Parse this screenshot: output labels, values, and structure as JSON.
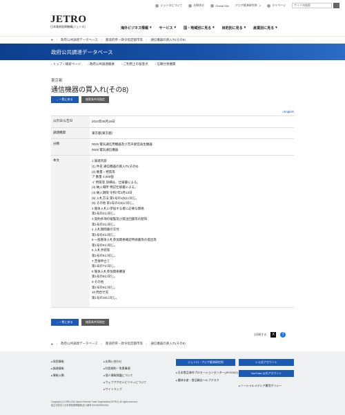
{
  "utility": {
    "about": "ジェトロについて",
    "contact": "お問合せ",
    "global": "Global Site",
    "library": "アジア経済研究所",
    "mypage": "マイページ",
    "search_placeholder": "サイト内検索"
  },
  "logo": {
    "mark": "JETRO",
    "sub": "日本貿易振興機構(ジェトロ)"
  },
  "gnav": [
    "海外ビジネス情報",
    "サービス",
    "国・地域別に見る",
    "目的別に見る",
    "産業別に見る"
  ],
  "breadcrumb": [
    "政府公共調達データベース",
    "都道府県・政令指定都市等",
    "通信機器の買入れ(その8)"
  ],
  "banner_title": "政府公共調達データベース",
  "subnav": [
    "トップ・検索ページ",
    "政府公共調達概要",
    "ご利用上の留意点",
    "信頼付善機関"
  ],
  "prefecture": "東京都",
  "page_title": "通信機器の買入れ(その8)",
  "buttons": {
    "back": "一覧に戻る",
    "conditions": "検索条件再指定"
  },
  "english_link": "English",
  "table": {
    "rows": [
      {
        "label": "公示日/公告日",
        "lines": [
          "2024年05月15日"
        ]
      },
      {
        "label": "調達機関",
        "lines": [
          "東京都(東京都)"
        ]
      },
      {
        "label": "分類",
        "lines": [
          "0025 電気通信用機器及び音声録音再生機器",
          "0028 電気通信機器"
        ]
      },
      {
        "label": "本文",
        "lines": [
          "1 調達内容",
          "(1) 件名 通信機器の買入れ(その8)",
          "(2) 数量・特質等",
          "ア 数量 4,000個",
          "イ 特質等 詳細は、仕様書による。",
          "(3) 納入場所 特記仕様書による。",
          "(4) 納入期限 令和7年3月13日",
          "(5) 入札方法 第1号の1(5)に同じ。",
          "(6) その他 第1号の1(6)に同じ。",
          "2 競争入札に参加する者に必要な資格",
          "第1号の2に同じ。",
          "3 契約条項の縦覧及び発注回書等の配布",
          "第1号の3に同じ。",
          "4 入札期間書の交付",
          "第1号の4に同じ。",
          "5 一般競争入札参加資格確認申請書等の提出等",
          "第1号の5に同じ。",
          "6 入札手続等",
          "第1号の6に同じ。",
          "7 苦情申立て",
          "第1号の7に同じ。",
          "8 競争入札参加資格審査",
          "第1号の8に同じ。",
          "9 その他",
          "第1号の9に同じ。",
          "10 問合せ先",
          "第1号の10に同じ。"
        ]
      }
    ]
  },
  "share": {
    "bookmark": "印刷する",
    "x": "X",
    "fb": "f"
  },
  "footer": {
    "col1": [
      "採用情報",
      "調達情報",
      "情報公開"
    ],
    "col2": [
      "お問い合わせ",
      "利用規約・免責事項",
      "個人情報保護について",
      "ウェブアクセシビリティについて",
      "サイトマップ"
    ],
    "btn_ide": "ジェトロ・アジア経済研究所",
    "link_jfoodo": "日本食品海外プロモーションセンター(JFOODO)",
    "link_library": "農林水産・食品輸出ヘルプデスク",
    "btn_x": "X 公式アカウント",
    "btn_yt": "YouTube 公式アカウント",
    "link_social": "ソーシャルメディア運用ポリシー",
    "copyright": "Copyright (C) 1995-2024 Japan External Trade Organization(JETRO). All rights reserved.",
    "copyright2": "独立行政法人日本貿易振興機構(法人番号 6010405003434)"
  }
}
